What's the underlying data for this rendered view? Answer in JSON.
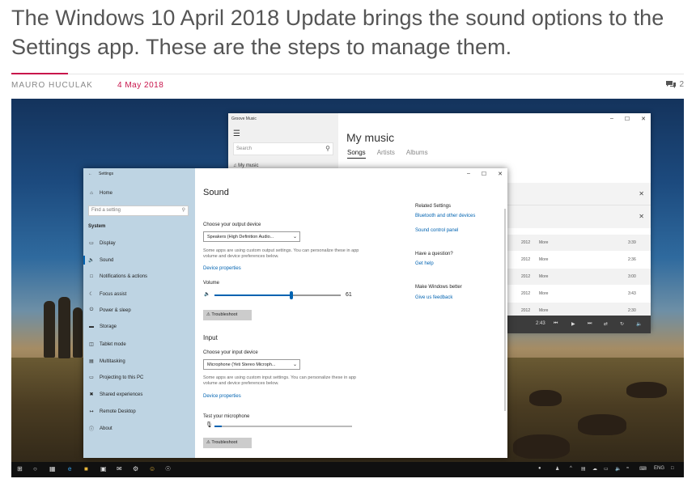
{
  "article": {
    "headline": "The Windows 10 April 2018 Update brings the sound options to the Settings app. These are the steps to manage them.",
    "author": "MAURO HUCULAK",
    "date": "4 May 2018",
    "comment_count": "2"
  },
  "groove": {
    "title": "Groove Music",
    "search_placeholder": "Search",
    "nav_item": "My music",
    "heading": "My music",
    "tabs": [
      "Songs",
      "Artists",
      "Albums"
    ],
    "songs": [
      {
        "year": "2012",
        "more": "More",
        "time": "3:39"
      },
      {
        "year": "2012",
        "more": "More",
        "time": "2:36"
      },
      {
        "year": "2012",
        "more": "More",
        "time": "3:00"
      },
      {
        "year": "2012",
        "more": "More",
        "time": "3:43"
      },
      {
        "year": "2012",
        "more": "More",
        "time": "2:30"
      }
    ],
    "player_time": "2:43"
  },
  "settings": {
    "title": "Settings",
    "home": "Home",
    "find_placeholder": "Find a setting",
    "section": "System",
    "nav": [
      "Display",
      "Sound",
      "Notifications & actions",
      "Focus assist",
      "Power & sleep",
      "Storage",
      "Tablet mode",
      "Multitasking",
      "Projecting to this PC",
      "Shared experiences",
      "Remote Desktop",
      "About"
    ],
    "active_nav": "Sound",
    "page_title": "Sound",
    "output_label": "Choose your output device",
    "output_value": "Speakers (High Definition Audio...",
    "output_note": "Some apps are using custom output settings. You can personalize these in app volume and device preferences below.",
    "device_properties": "Device properties",
    "volume_label": "Volume",
    "volume_value": "61",
    "volume_level": 0.61,
    "troubleshoot": "Troubleshoot",
    "input_heading": "Input",
    "input_label": "Choose your input device",
    "input_value": "Microphone (Yeti Stereo Microph...",
    "input_note": "Some apps are using custom input settings. You can personalize these in app volume and device preferences below.",
    "test_mic_label": "Test your microphone",
    "mic_level": 0.05,
    "related_heading": "Related Settings",
    "related_link1": "Bluetooth and other devices",
    "related_link2": "Sound control panel",
    "question_heading": "Have a question?",
    "get_help": "Get help",
    "better_heading": "Make Windows better",
    "feedback": "Give us feedback"
  },
  "taskbar": {
    "lang": "ENG"
  }
}
